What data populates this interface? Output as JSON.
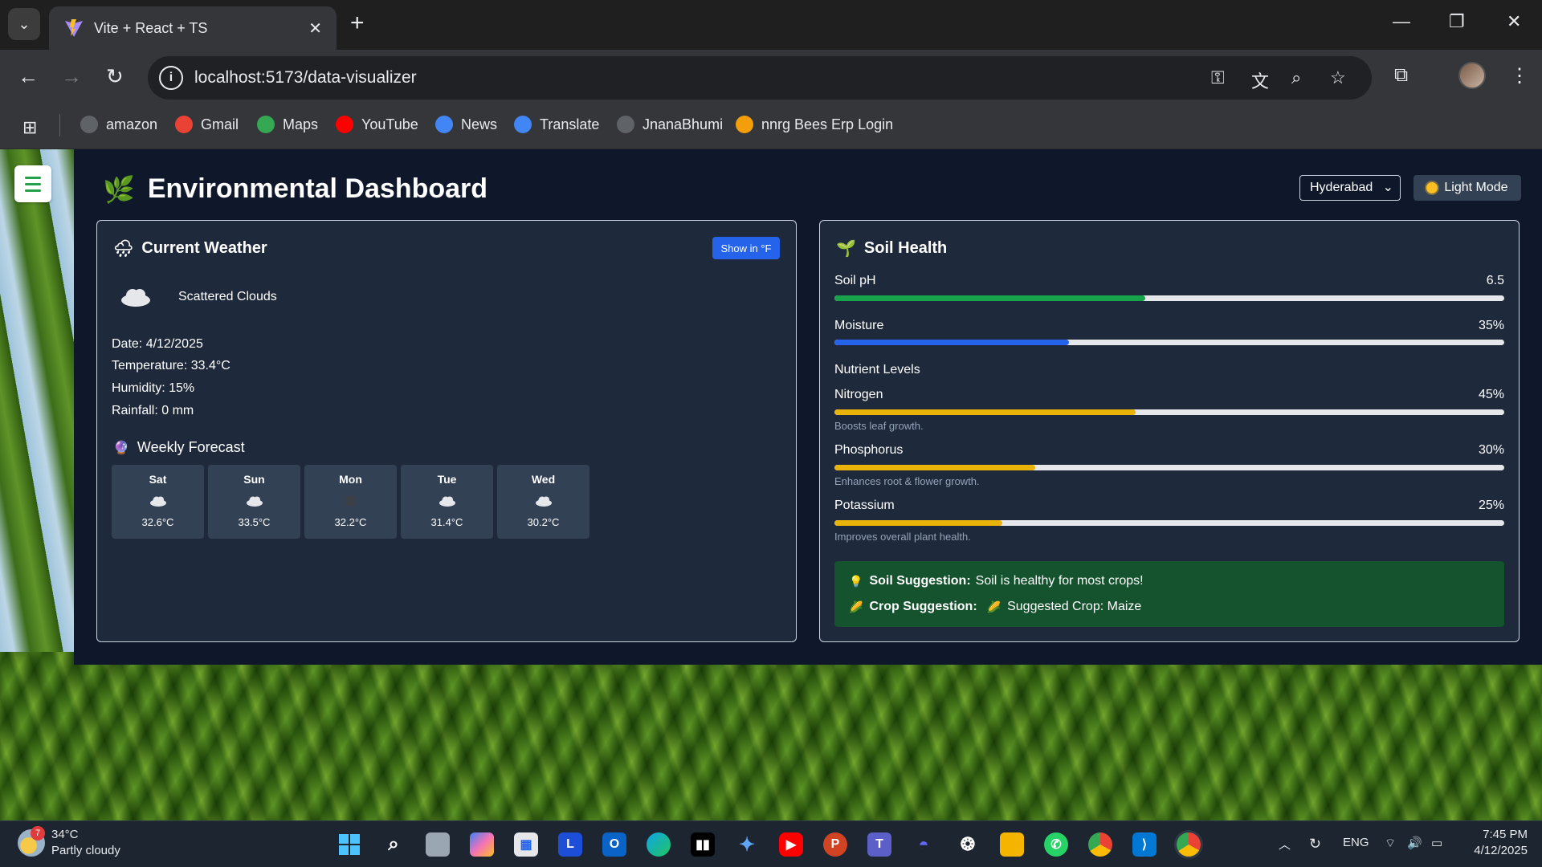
{
  "browser": {
    "tab_title": "Vite + React + TS",
    "url": "localhost:5173/data-visualizer",
    "bookmarks": [
      {
        "label": "amazon",
        "icon": "globe-icon",
        "color": "#5f6368"
      },
      {
        "label": "Gmail",
        "icon": "gmail-icon",
        "color": "#ea4335"
      },
      {
        "label": "Maps",
        "icon": "maps-icon",
        "color": "#34a853"
      },
      {
        "label": "YouTube",
        "icon": "youtube-icon",
        "color": "#ff0000"
      },
      {
        "label": "News",
        "icon": "news-icon",
        "color": "#4285f4"
      },
      {
        "label": "Translate",
        "icon": "translate-icon",
        "color": "#4285f4"
      },
      {
        "label": "JnanaBhumi",
        "icon": "globe-icon",
        "color": "#5f6368"
      },
      {
        "label": "nnrg Bees Erp Login",
        "icon": "bees-icon",
        "color": "#f59e0b"
      }
    ]
  },
  "dashboard": {
    "title": "Environmental Dashboard",
    "city": "Hyderabad",
    "mode_button": "Light Mode"
  },
  "weather": {
    "title": "Current Weather",
    "unit_toggle": "Show in °F",
    "condition": "Scattered Clouds",
    "date": "Date: 4/12/2025",
    "temperature": "Temperature: 33.4°C",
    "humidity": "Humidity: 15%",
    "rainfall": "Rainfall: 0 mm",
    "forecast_title": "Weekly Forecast",
    "forecast": [
      {
        "day": "Sat",
        "temp": "32.6°C",
        "icon": "cloud-icon"
      },
      {
        "day": "Sun",
        "temp": "33.5°C",
        "icon": "cloud-icon"
      },
      {
        "day": "Mon",
        "temp": "32.2°C",
        "icon": "mist-icon"
      },
      {
        "day": "Tue",
        "temp": "31.4°C",
        "icon": "cloud-icon"
      },
      {
        "day": "Wed",
        "temp": "30.2°C",
        "icon": "cloud-icon"
      }
    ]
  },
  "soil": {
    "title": "Soil Health",
    "ph": {
      "label": "Soil pH",
      "value": "6.5",
      "fraction": 0.464,
      "color": "#16a34a"
    },
    "moisture": {
      "label": "Moisture",
      "value": "35%",
      "fraction": 0.35,
      "color": "#2563eb"
    },
    "nutrient_title": "Nutrient Levels",
    "nutrients": [
      {
        "label": "Nitrogen",
        "value": "45%",
        "fraction": 0.45,
        "desc": "Boosts leaf growth.",
        "color": "#eab308"
      },
      {
        "label": "Phosphorus",
        "value": "30%",
        "fraction": 0.3,
        "desc": "Enhances root & flower growth.",
        "color": "#eab308"
      },
      {
        "label": "Potassium",
        "value": "25%",
        "fraction": 0.25,
        "desc": "Improves overall plant health.",
        "color": "#eab308"
      }
    ],
    "soil_suggestion_label": "Soil Suggestion:",
    "soil_suggestion": "Soil is healthy for most crops!",
    "crop_suggestion_label": "Crop Suggestion:",
    "crop_suggestion": "Suggested Crop: Maize"
  },
  "taskbar": {
    "weather_temp": "34°C",
    "weather_desc": "Partly cloudy",
    "weather_badge": "7",
    "lang": "ENG",
    "time": "7:45 PM",
    "date": "4/12/2025"
  }
}
